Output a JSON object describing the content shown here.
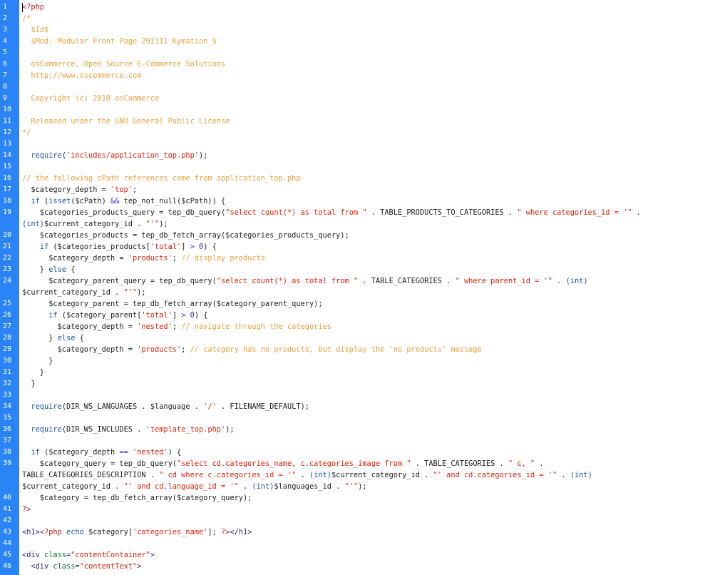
{
  "editor": {
    "lines": [
      {
        "n": "1",
        "parts": [
          [
            "n",
            "<?php"
          ]
        ]
      },
      {
        "n": "2",
        "parts": [
          [
            "c",
            "/*"
          ]
        ]
      },
      {
        "n": "3",
        "parts": [
          [
            "c",
            "  $Id$"
          ]
        ]
      },
      {
        "n": "4",
        "parts": [
          [
            "c",
            "  $Mod: Modular Front Page 201111 Kymation $"
          ]
        ]
      },
      {
        "n": "5",
        "parts": []
      },
      {
        "n": "6",
        "parts": [
          [
            "c",
            "  osCommerce, Open Source E-Commerce Solutions"
          ]
        ]
      },
      {
        "n": "7",
        "parts": [
          [
            "c",
            "  http://www.oscommerce.com"
          ]
        ]
      },
      {
        "n": "8",
        "parts": []
      },
      {
        "n": "9",
        "parts": [
          [
            "c",
            "  Copyright (c) 2010 osCommerce"
          ]
        ]
      },
      {
        "n": "10",
        "parts": []
      },
      {
        "n": "11",
        "parts": [
          [
            "c",
            "  Released under the GNU General Public License"
          ]
        ]
      },
      {
        "n": "12",
        "parts": [
          [
            "c",
            "*/"
          ]
        ]
      },
      {
        "n": "13",
        "parts": []
      },
      {
        "n": "14",
        "parts": [
          [
            "v",
            "  "
          ],
          [
            "k",
            "require"
          ],
          [
            "v",
            "("
          ],
          [
            "s",
            "'includes/application_top.php'"
          ],
          [
            "v",
            ");"
          ]
        ]
      },
      {
        "n": "15",
        "parts": []
      },
      {
        "n": "16",
        "parts": [
          [
            "c",
            "// the following cPath references come from application_top.php"
          ]
        ]
      },
      {
        "n": "17",
        "parts": [
          [
            "v",
            "  $category_depth = "
          ],
          [
            "s",
            "'top'"
          ],
          [
            "v",
            ";"
          ]
        ]
      },
      {
        "n": "18",
        "parts": [
          [
            "v",
            "  "
          ],
          [
            "k",
            "if"
          ],
          [
            "v",
            " ("
          ],
          [
            "k",
            "isset"
          ],
          [
            "v",
            "($cPath) "
          ],
          [
            "o",
            "&&"
          ],
          [
            "v",
            " tep_not_null($cPath)) {"
          ]
        ]
      },
      {
        "n": "19",
        "parts": [
          [
            "v",
            "    $categories_products_query = tep_db_query("
          ],
          [
            "s",
            "\"select count(*) as total from \""
          ],
          [
            "v",
            " . TABLE_PRODUCTS_TO_CATEGORIES . "
          ],
          [
            "s",
            "\" where categories_id = '\""
          ],
          [
            "v",
            " ."
          ]
        ],
        "cont": [
          [
            [
              "k",
              "(int)"
            ],
            [
              "v",
              "$current_category_id . "
            ],
            [
              "s",
              "\"'\""
            ],
            [
              "v",
              ");"
            ]
          ]
        ]
      },
      {
        "n": "20",
        "parts": [
          [
            "v",
            "    $categories_products = tep_db_fetch_array($categories_products_query);"
          ]
        ]
      },
      {
        "n": "21",
        "parts": [
          [
            "v",
            "    "
          ],
          [
            "k",
            "if"
          ],
          [
            "v",
            " ($categories_products["
          ],
          [
            "s",
            "'total'"
          ],
          [
            "v",
            "] "
          ],
          [
            "o",
            "> 0"
          ],
          [
            "v",
            ") {"
          ]
        ]
      },
      {
        "n": "22",
        "parts": [
          [
            "v",
            "      $category_depth = "
          ],
          [
            "s",
            "'products'"
          ],
          [
            "v",
            "; "
          ],
          [
            "c",
            "// display products"
          ]
        ]
      },
      {
        "n": "23",
        "parts": [
          [
            "v",
            "    } "
          ],
          [
            "k",
            "else"
          ],
          [
            "v",
            " {"
          ]
        ]
      },
      {
        "n": "24",
        "parts": [
          [
            "v",
            "      $category_parent_query = tep_db_query("
          ],
          [
            "s",
            "\"select count(*) as total from \""
          ],
          [
            "v",
            " . TABLE_CATEGORIES . "
          ],
          [
            "s",
            "\" where parent_id = '\""
          ],
          [
            "v",
            " . "
          ],
          [
            "k",
            "(int)"
          ]
        ],
        "cont": [
          [
            [
              "v",
              "$current_category_id . "
            ],
            [
              "s",
              "\"'\""
            ],
            [
              "v",
              ");"
            ]
          ]
        ]
      },
      {
        "n": "25",
        "parts": [
          [
            "v",
            "      $category_parent = tep_db_fetch_array($category_parent_query);"
          ]
        ]
      },
      {
        "n": "26",
        "parts": [
          [
            "v",
            "      "
          ],
          [
            "k",
            "if"
          ],
          [
            "v",
            " ($category_parent["
          ],
          [
            "s",
            "'total'"
          ],
          [
            "v",
            "] "
          ],
          [
            "o",
            "> 0"
          ],
          [
            "v",
            ") {"
          ]
        ]
      },
      {
        "n": "27",
        "parts": [
          [
            "v",
            "        $category_depth = "
          ],
          [
            "s",
            "'nested'"
          ],
          [
            "v",
            "; "
          ],
          [
            "c",
            "// navigate through the categories"
          ]
        ]
      },
      {
        "n": "28",
        "parts": [
          [
            "v",
            "      } "
          ],
          [
            "k",
            "else"
          ],
          [
            "v",
            " {"
          ]
        ]
      },
      {
        "n": "29",
        "parts": [
          [
            "v",
            "        $category_depth = "
          ],
          [
            "s",
            "'products'"
          ],
          [
            "v",
            "; "
          ],
          [
            "c",
            "// category has no products, but display the 'no products' message"
          ]
        ]
      },
      {
        "n": "30",
        "parts": [
          [
            "v",
            "      }"
          ]
        ]
      },
      {
        "n": "31",
        "parts": [
          [
            "v",
            "    }"
          ]
        ]
      },
      {
        "n": "32",
        "parts": [
          [
            "v",
            "  }"
          ]
        ]
      },
      {
        "n": "33",
        "parts": []
      },
      {
        "n": "34",
        "parts": [
          [
            "v",
            "  "
          ],
          [
            "k",
            "require"
          ],
          [
            "v",
            "(DIR_WS_LANGUAGES . $language . "
          ],
          [
            "s",
            "'/'"
          ],
          [
            "v",
            " . FILENAME_DEFAULT);"
          ]
        ]
      },
      {
        "n": "35",
        "parts": []
      },
      {
        "n": "36",
        "parts": [
          [
            "v",
            "  "
          ],
          [
            "k",
            "require"
          ],
          [
            "v",
            "(DIR_WS_INCLUDES . "
          ],
          [
            "s",
            "'template_top.php'"
          ],
          [
            "v",
            ");"
          ]
        ]
      },
      {
        "n": "37",
        "parts": []
      },
      {
        "n": "38",
        "parts": [
          [
            "v",
            "  "
          ],
          [
            "k",
            "if"
          ],
          [
            "v",
            " ($category_depth "
          ],
          [
            "o",
            "=="
          ],
          [
            "v",
            " "
          ],
          [
            "s",
            "'nested'"
          ],
          [
            "v",
            ") {"
          ]
        ]
      },
      {
        "n": "39",
        "parts": [
          [
            "v",
            "    $category_query = tep_db_query("
          ],
          [
            "s",
            "\"select cd.categories_name, c.categories_image from \""
          ],
          [
            "v",
            " . TABLE_CATEGORIES . "
          ],
          [
            "s",
            "\" c, \""
          ],
          [
            "v",
            " ."
          ]
        ],
        "cont": [
          [
            [
              "v",
              "TABLE_CATEGORIES_DESCRIPTION . "
            ],
            [
              "s",
              "\" cd where c.categories_id = '\""
            ],
            [
              "v",
              " . "
            ],
            [
              "k",
              "(int)"
            ],
            [
              "v",
              "$current_category_id . "
            ],
            [
              "s",
              "\"' and cd.categories_id = '\""
            ],
            [
              "v",
              " . "
            ],
            [
              "k",
              "(int)"
            ]
          ],
          [
            [
              "v",
              "$current_category_id . "
            ],
            [
              "s",
              "\"' and cd.language_id = '\""
            ],
            [
              "v",
              " . "
            ],
            [
              "k",
              "(int)"
            ],
            [
              "v",
              "$languages_id . "
            ],
            [
              "s",
              "\"'\""
            ],
            [
              "v",
              ");"
            ]
          ]
        ]
      },
      {
        "n": "40",
        "parts": [
          [
            "v",
            "    $category = tep_db_fetch_array($category_query);"
          ]
        ]
      },
      {
        "n": "41",
        "parts": [
          [
            "n",
            "?>"
          ]
        ]
      },
      {
        "n": "42",
        "parts": []
      },
      {
        "n": "43",
        "parts": [
          [
            "t",
            "<h1>"
          ],
          [
            "n",
            "<?php "
          ],
          [
            "k",
            "echo"
          ],
          [
            "v",
            " $category["
          ],
          [
            "s",
            "'categories_name'"
          ],
          [
            "v",
            "]; "
          ],
          [
            "n",
            "?>"
          ],
          [
            "t",
            "</h1>"
          ]
        ]
      },
      {
        "n": "44",
        "parts": []
      },
      {
        "n": "45",
        "parts": [
          [
            "t",
            "<div "
          ],
          [
            "a",
            "class"
          ],
          [
            "t",
            "="
          ],
          [
            "s",
            "\"contentContainer\""
          ],
          [
            "t",
            ">"
          ]
        ]
      },
      {
        "n": "46",
        "parts": [
          [
            "t",
            "  <div "
          ],
          [
            "a",
            "class"
          ],
          [
            "t",
            "="
          ],
          [
            "s",
            "\"contentText\""
          ],
          [
            "t",
            ">"
          ]
        ]
      }
    ]
  }
}
